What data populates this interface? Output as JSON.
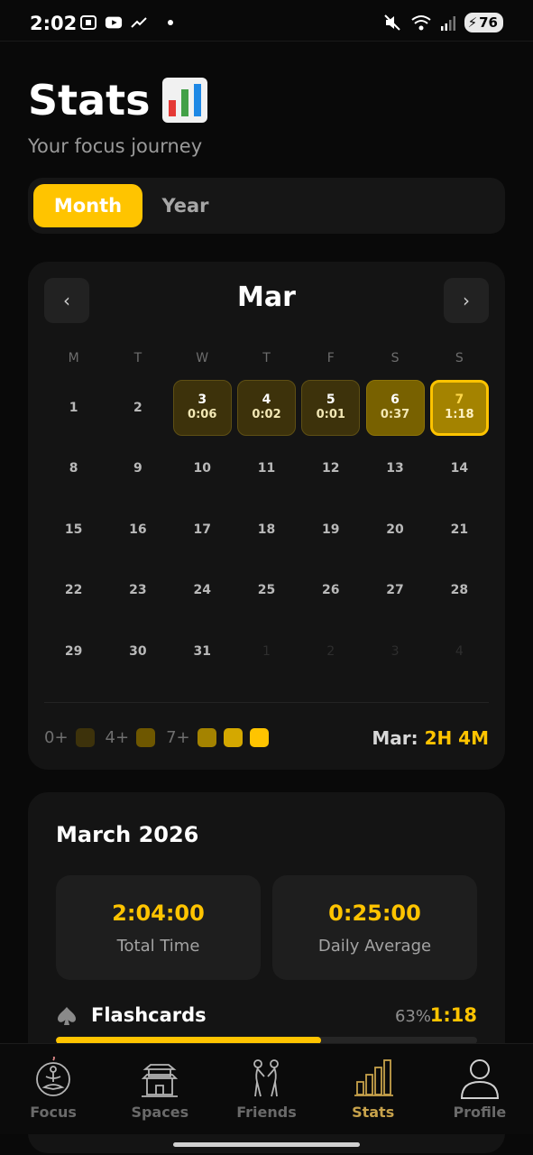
{
  "status_bar": {
    "time": "2:02",
    "battery": "76"
  },
  "header": {
    "title": "Stats",
    "subtitle": "Your focus journey"
  },
  "toggle": {
    "month": "Month",
    "year": "Year"
  },
  "calendar": {
    "month": "Mar",
    "prev": "‹",
    "next": "›",
    "dows": [
      "M",
      "T",
      "W",
      "T",
      "F",
      "S",
      "S"
    ],
    "weeks": [
      [
        {
          "d": "1"
        },
        {
          "d": "2"
        },
        {
          "d": "3",
          "t": "0:06",
          "lvl": 1
        },
        {
          "d": "4",
          "t": "0:02",
          "lvl": 1
        },
        {
          "d": "5",
          "t": "0:01",
          "lvl": 1
        },
        {
          "d": "6",
          "t": "0:37",
          "lvl": 2
        },
        {
          "d": "7",
          "t": "1:18",
          "lvl": 3
        }
      ],
      [
        {
          "d": "8"
        },
        {
          "d": "9"
        },
        {
          "d": "10"
        },
        {
          "d": "11"
        },
        {
          "d": "12"
        },
        {
          "d": "13"
        },
        {
          "d": "14"
        }
      ],
      [
        {
          "d": "15"
        },
        {
          "d": "16"
        },
        {
          "d": "17"
        },
        {
          "d": "18"
        },
        {
          "d": "19"
        },
        {
          "d": "20"
        },
        {
          "d": "21"
        }
      ],
      [
        {
          "d": "22"
        },
        {
          "d": "23"
        },
        {
          "d": "24"
        },
        {
          "d": "25"
        },
        {
          "d": "26"
        },
        {
          "d": "27"
        },
        {
          "d": "28"
        }
      ],
      [
        {
          "d": "29"
        },
        {
          "d": "30"
        },
        {
          "d": "31"
        },
        {
          "d": "1",
          "muted": true
        },
        {
          "d": "2",
          "muted": true
        },
        {
          "d": "3",
          "muted": true
        },
        {
          "d": "4",
          "muted": true
        }
      ]
    ],
    "legend": {
      "l0": "0+",
      "l4": "4+",
      "l7": "7+"
    },
    "legend_colors": [
      "#3d320b",
      "#6e5700",
      "#a48300",
      "#d4a800",
      "#ffc400"
    ],
    "total_label": "Mar:",
    "total_value": "2H 4M"
  },
  "summary": {
    "title": "March 2026",
    "total_time": "2:04:00",
    "total_time_label": "Total Time",
    "daily_avg": "0:25:00",
    "daily_avg_label": "Daily Average",
    "category": {
      "name": "Flashcards",
      "pct": "63%",
      "time": "1:18",
      "progress": 0.63,
      "icon": "spade-icon"
    }
  },
  "nav": {
    "focus": "Focus",
    "spaces": "Spaces",
    "friends": "Friends",
    "stats": "Stats",
    "profile": "Profile",
    "active": "stats"
  },
  "colors": {
    "accent": "#ffc400",
    "background": "#090909",
    "card": "#141414"
  }
}
